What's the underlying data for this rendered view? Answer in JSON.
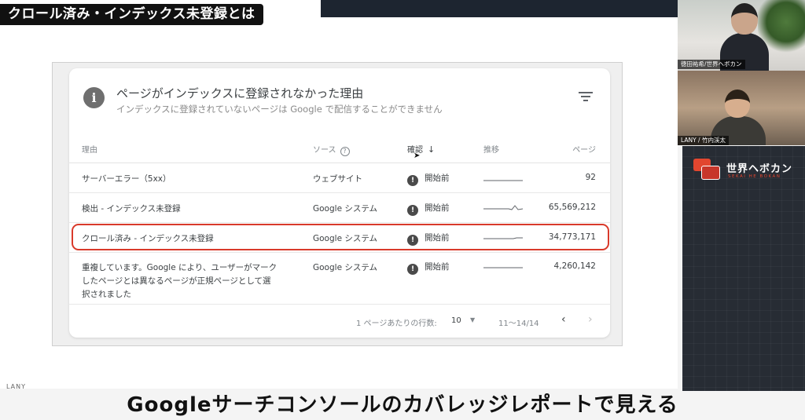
{
  "slide": {
    "title_badge": "クロール済み・インデックス未登録とは",
    "corner_text": "LANY",
    "caption": "Googleサーチコンソールのカバレッジレポートで見える"
  },
  "report": {
    "title": "ページがインデックスに登録されなかった理由",
    "subtitle": "インデックスに登録されていないページは Google で配信することができません",
    "icons": {
      "info": "info-icon",
      "filter": "filter-icon",
      "status": "alert-icon"
    },
    "columns": {
      "reason": "理由",
      "source": "ソース",
      "validation": "確認",
      "trend": "推移",
      "pages": "ページ"
    },
    "rows": [
      {
        "reason": "サーバーエラー（5xx）",
        "source": "ウェブサイト",
        "status": "開始前",
        "pages": "92"
      },
      {
        "reason": "検出 - インデックス未登録",
        "source": "Google システム",
        "status": "開始前",
        "pages": "65,569,212"
      },
      {
        "reason": "クロール済み - インデックス未登録",
        "source": "Google システム",
        "status": "開始前",
        "pages": "34,773,171"
      },
      {
        "reason": "重複しています。Google により、ユーザーがマークしたページとは異なるページが正規ページとして選択されました",
        "source": "Google システム",
        "status": "開始前",
        "pages": "4,260,142"
      }
    ],
    "highlighted_row": 2,
    "highlight_color": "#d93a2b",
    "pagination": {
      "rows_per_page_label": "1 ページあたりの行数:",
      "rows_per_page_value": "10",
      "range": "11～14/14"
    }
  },
  "participants": [
    {
      "name": "徳田祐希/世界ヘボカン"
    },
    {
      "name": "LANY / 竹内渓太"
    }
  ],
  "brand": {
    "name": "世界ヘボカン",
    "tagline": "SEKAI HE BOKAN",
    "accent": "#e2462f"
  }
}
